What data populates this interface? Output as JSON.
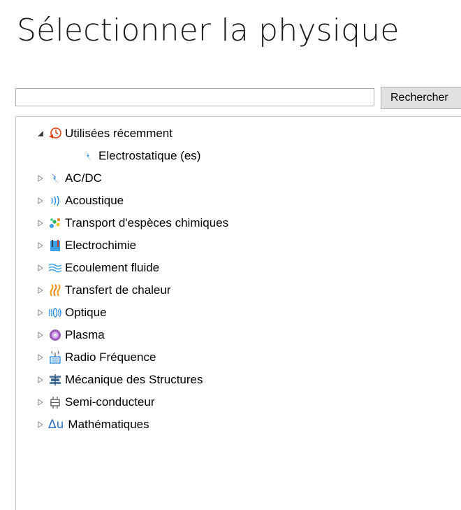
{
  "page": {
    "title": "Sélectionner la physique"
  },
  "search": {
    "input_value": "",
    "button_label": "Rechercher"
  },
  "tree": {
    "recent": {
      "label": "Utilisées récemment",
      "expanded": true,
      "children": [
        {
          "label": "Electrostatique (es)",
          "icon": "lightning-icon"
        }
      ]
    },
    "items": [
      {
        "label": "AC/DC",
        "icon": "lightning-icon"
      },
      {
        "label": "Acoustique",
        "icon": "sound-waves-icon"
      },
      {
        "label": "Transport d'espèces chimiques",
        "icon": "molecules-icon"
      },
      {
        "label": "Electrochimie",
        "icon": "beaker-icon"
      },
      {
        "label": "Ecoulement fluide",
        "icon": "fluid-flow-icon"
      },
      {
        "label": "Transfert de chaleur",
        "icon": "heat-icon"
      },
      {
        "label": "Optique",
        "icon": "optics-icon"
      },
      {
        "label": "Plasma",
        "icon": "plasma-icon"
      },
      {
        "label": "Radio Fréquence",
        "icon": "antenna-icon"
      },
      {
        "label": "Mécanique des Structures",
        "icon": "structure-icon"
      },
      {
        "label": "Semi-conducteur",
        "icon": "semiconductor-icon"
      },
      {
        "label": "Mathématiques",
        "icon": "math-icon",
        "glyph": "Δu"
      }
    ]
  },
  "colors": {
    "lightning": "#1e8fe0",
    "acoustic": "#2a8de0",
    "heat": "#f39c12",
    "plasma": "#9b59b6",
    "electrochem": "#3aa0e8",
    "recent_arrow": "#e04010",
    "expander": "#8a8a8a"
  }
}
